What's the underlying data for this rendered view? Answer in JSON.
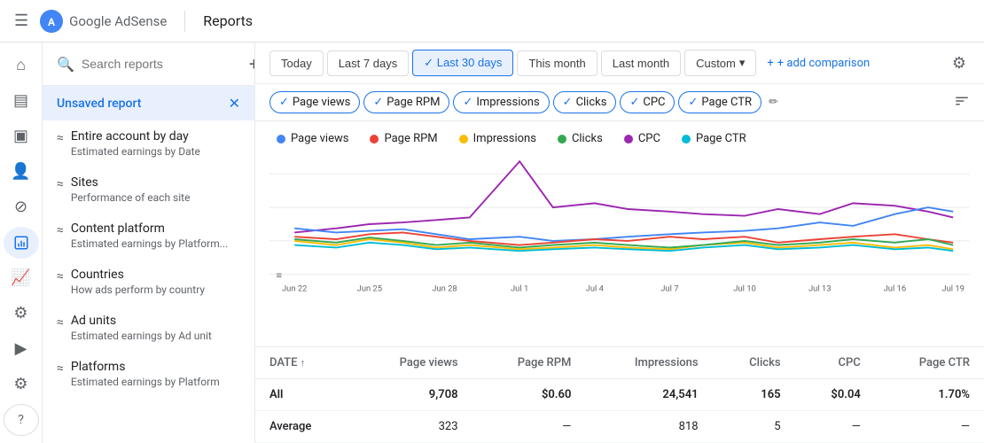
{
  "topnav": {
    "hamburger": "☰",
    "brand": "Google AdSense",
    "divider": true,
    "title": "Reports"
  },
  "filters": {
    "buttons": [
      {
        "id": "today",
        "label": "Today",
        "active": false
      },
      {
        "id": "last7",
        "label": "Last 7 days",
        "active": false
      },
      {
        "id": "last30",
        "label": "Last 30 days",
        "active": true,
        "check": "✓"
      },
      {
        "id": "thismonth",
        "label": "This month",
        "active": false
      },
      {
        "id": "lastmonth",
        "label": "Last month",
        "active": false
      },
      {
        "id": "custom",
        "label": "Custom",
        "active": false,
        "dropdown": true
      }
    ],
    "add_comparison": "+ add comparison"
  },
  "metrics": [
    {
      "id": "pageviews",
      "label": "Page views",
      "active": true,
      "color": "#4285f4"
    },
    {
      "id": "pagerpm",
      "label": "Page RPM",
      "active": true,
      "color": "#ea4335"
    },
    {
      "id": "impressions",
      "label": "Impressions",
      "active": true,
      "color": "#fbbc04"
    },
    {
      "id": "clicks",
      "label": "Clicks",
      "active": true,
      "color": "#34a853"
    },
    {
      "id": "cpc",
      "label": "CPC",
      "active": true,
      "color": "#9c27b0"
    },
    {
      "id": "pagectr",
      "label": "Page CTR",
      "active": true,
      "color": "#00bcd4"
    }
  ],
  "legend": [
    {
      "label": "Page views",
      "color": "#4285f4"
    },
    {
      "label": "Page RPM",
      "color": "#ea4335"
    },
    {
      "label": "Impressions",
      "color": "#fbbc04"
    },
    {
      "label": "Clicks",
      "color": "#34a853"
    },
    {
      "label": "CPC",
      "color": "#9c27b0"
    },
    {
      "label": "Page CTR",
      "color": "#00bcd4"
    }
  ],
  "chart": {
    "x_labels": [
      "Jun 22",
      "Jun 25",
      "Jun 28",
      "Jul 1",
      "Jul 4",
      "Jul 7",
      "Jul 10",
      "Jul 13",
      "Jul 16",
      "Jul 19"
    ]
  },
  "search": {
    "placeholder": "Search reports"
  },
  "sidebar_items": [
    {
      "id": "entire-account",
      "name": "Entire account by day",
      "desc": "Estimated earnings by Date",
      "icon": "≈"
    },
    {
      "id": "sites",
      "name": "Sites",
      "desc": "Performance of each site",
      "icon": "≈"
    },
    {
      "id": "content-platform",
      "name": "Content platform",
      "desc": "Estimated earnings by Platform...",
      "icon": "≈"
    },
    {
      "id": "countries",
      "name": "Countries",
      "desc": "How ads perform by country",
      "icon": "≈"
    },
    {
      "id": "ad-units",
      "name": "Ad units",
      "desc": "Estimated earnings by Ad unit",
      "icon": "≈"
    },
    {
      "id": "platforms",
      "name": "Platforms",
      "desc": "Estimated earnings by Platform",
      "icon": "≈"
    }
  ],
  "unsaved_report": {
    "label": "Unsaved report"
  },
  "table": {
    "columns": [
      {
        "id": "date",
        "label": "DATE",
        "sort": "↑",
        "align": "left"
      },
      {
        "id": "pageviews",
        "label": "Page views",
        "align": "right"
      },
      {
        "id": "pagerpm",
        "label": "Page RPM",
        "align": "right"
      },
      {
        "id": "impressions",
        "label": "Impressions",
        "align": "right"
      },
      {
        "id": "clicks",
        "label": "Clicks",
        "align": "right"
      },
      {
        "id": "cpc",
        "label": "CPC",
        "align": "right"
      },
      {
        "id": "pagectr",
        "label": "Page CTR",
        "align": "right"
      }
    ],
    "rows": [
      {
        "date": "All",
        "pageviews": "9,708",
        "pagerpm": "$0.60",
        "impressions": "24,541",
        "clicks": "165",
        "cpc": "$0.04",
        "pagectr": "1.70%",
        "is_all": true
      },
      {
        "date": "Average",
        "pageviews": "323",
        "pagerpm": "—",
        "impressions": "818",
        "clicks": "5",
        "cpc": "—",
        "pagectr": "—",
        "is_all": false
      }
    ]
  },
  "icon_nav": [
    {
      "id": "home",
      "icon": "⌂",
      "active": false
    },
    {
      "id": "content",
      "icon": "▤",
      "active": false
    },
    {
      "id": "ads",
      "icon": "▣",
      "active": false
    },
    {
      "id": "users",
      "icon": "👤",
      "active": false
    },
    {
      "id": "block",
      "icon": "⊘",
      "active": false
    },
    {
      "id": "reports",
      "icon": "📊",
      "active": true
    },
    {
      "id": "analytics",
      "icon": "📈",
      "active": false
    },
    {
      "id": "optimize",
      "icon": "⚙",
      "active": false
    },
    {
      "id": "media",
      "icon": "▶",
      "active": false
    },
    {
      "id": "settings2",
      "icon": "⚙",
      "active": false
    },
    {
      "id": "help",
      "icon": "?",
      "active": false
    }
  ]
}
